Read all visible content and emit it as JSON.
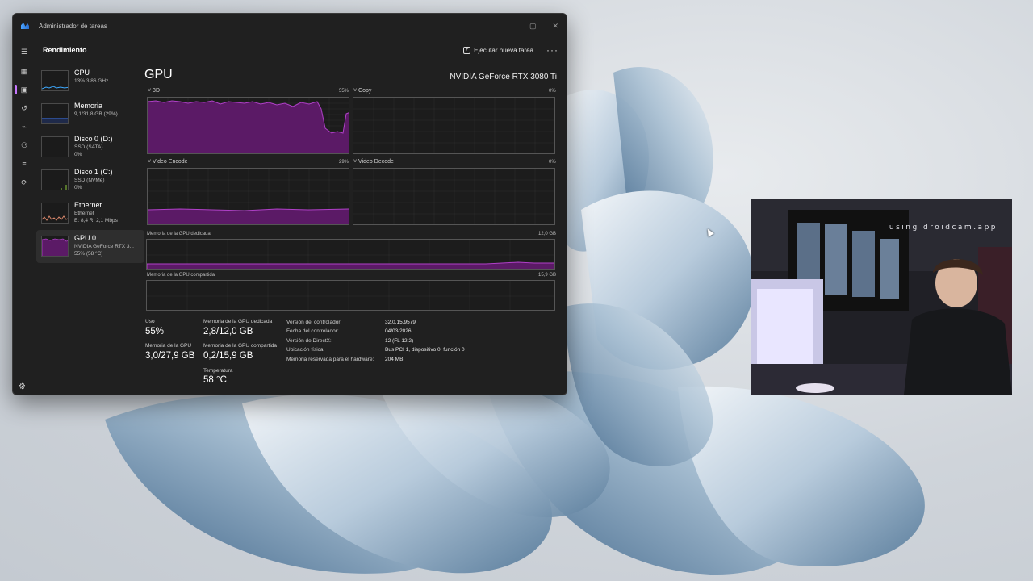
{
  "window": {
    "title": "Administrador de tareas",
    "minimize_glyph": "▢",
    "close_glyph": "✕",
    "page_heading": "Rendimiento",
    "run_task_label": "Ejecutar nueva tarea",
    "more_glyph": "···"
  },
  "rail_icons": [
    "hamburger-icon",
    "processes-icon",
    "performance-icon",
    "history-icon",
    "startup-icon",
    "users-icon",
    "details-icon",
    "services-icon"
  ],
  "devices": [
    {
      "name": "CPU",
      "line1": "13% 3,86 GHz",
      "line2": ""
    },
    {
      "name": "Memoria",
      "line1": "9,1/31,8 GB (29%)",
      "line2": ""
    },
    {
      "name": "Disco 0 (D:)",
      "line1": "SSD (SATA)",
      "line2": "0%"
    },
    {
      "name": "Disco 1 (C:)",
      "line1": "SSD (NVMe)",
      "line2": "0%"
    },
    {
      "name": "Ethernet",
      "line1": "Ethernet",
      "line2": "E: 8,4 R: 2,1 Mbps"
    },
    {
      "name": "GPU 0",
      "line1": "NVIDIA GeForce RTX 3...",
      "line2": "55% (58 °C)"
    }
  ],
  "gpu": {
    "title": "GPU",
    "model": "NVIDIA GeForce RTX 3080 Ti",
    "engines": [
      {
        "label": "3D",
        "value": "55%"
      },
      {
        "label": "Copy",
        "value": "0%"
      },
      {
        "label": "Video Encode",
        "value": "29%"
      },
      {
        "label": "Video Decode",
        "value": "0%"
      }
    ],
    "dedicated": {
      "label": "Memoria de la GPU dedicada",
      "max": "12,0 GB"
    },
    "shared": {
      "label": "Memoria de la GPU compartida",
      "max": "15,9 GB"
    },
    "stats": {
      "uso_label": "Uso",
      "uso": "55%",
      "gpu_mem_label": "Memoria de la GPU",
      "gpu_mem": "3,0/27,9 GB",
      "ded_label": "Memoria de la GPU dedicada",
      "ded": "2,8/12,0 GB",
      "shared_label": "Memoria de la GPU compartida",
      "shared": "0,2/15,9 GB",
      "temp_label": "Temperatura",
      "temp": "58 °C"
    },
    "info": [
      {
        "key": "Versión del controlador:",
        "val": "32.0.15.9579"
      },
      {
        "key": "Fecha del controlador:",
        "val": "04/03/2026"
      },
      {
        "key": "Versión de DirectX:",
        "val": "12 (FL 12.2)"
      },
      {
        "key": "Ubicación física:",
        "val": "Bus PCI 1, dispositivo 0, función 0"
      },
      {
        "key": "Memoria reservada para el hardware:",
        "val": "204 MB"
      }
    ]
  },
  "webcam": {
    "watermark": "using droidcam.app"
  },
  "colors": {
    "accent": "#c677ff",
    "gpu_fill": "#5b1a66",
    "gpu_line": "#b040c8",
    "window_bg": "#202020"
  }
}
